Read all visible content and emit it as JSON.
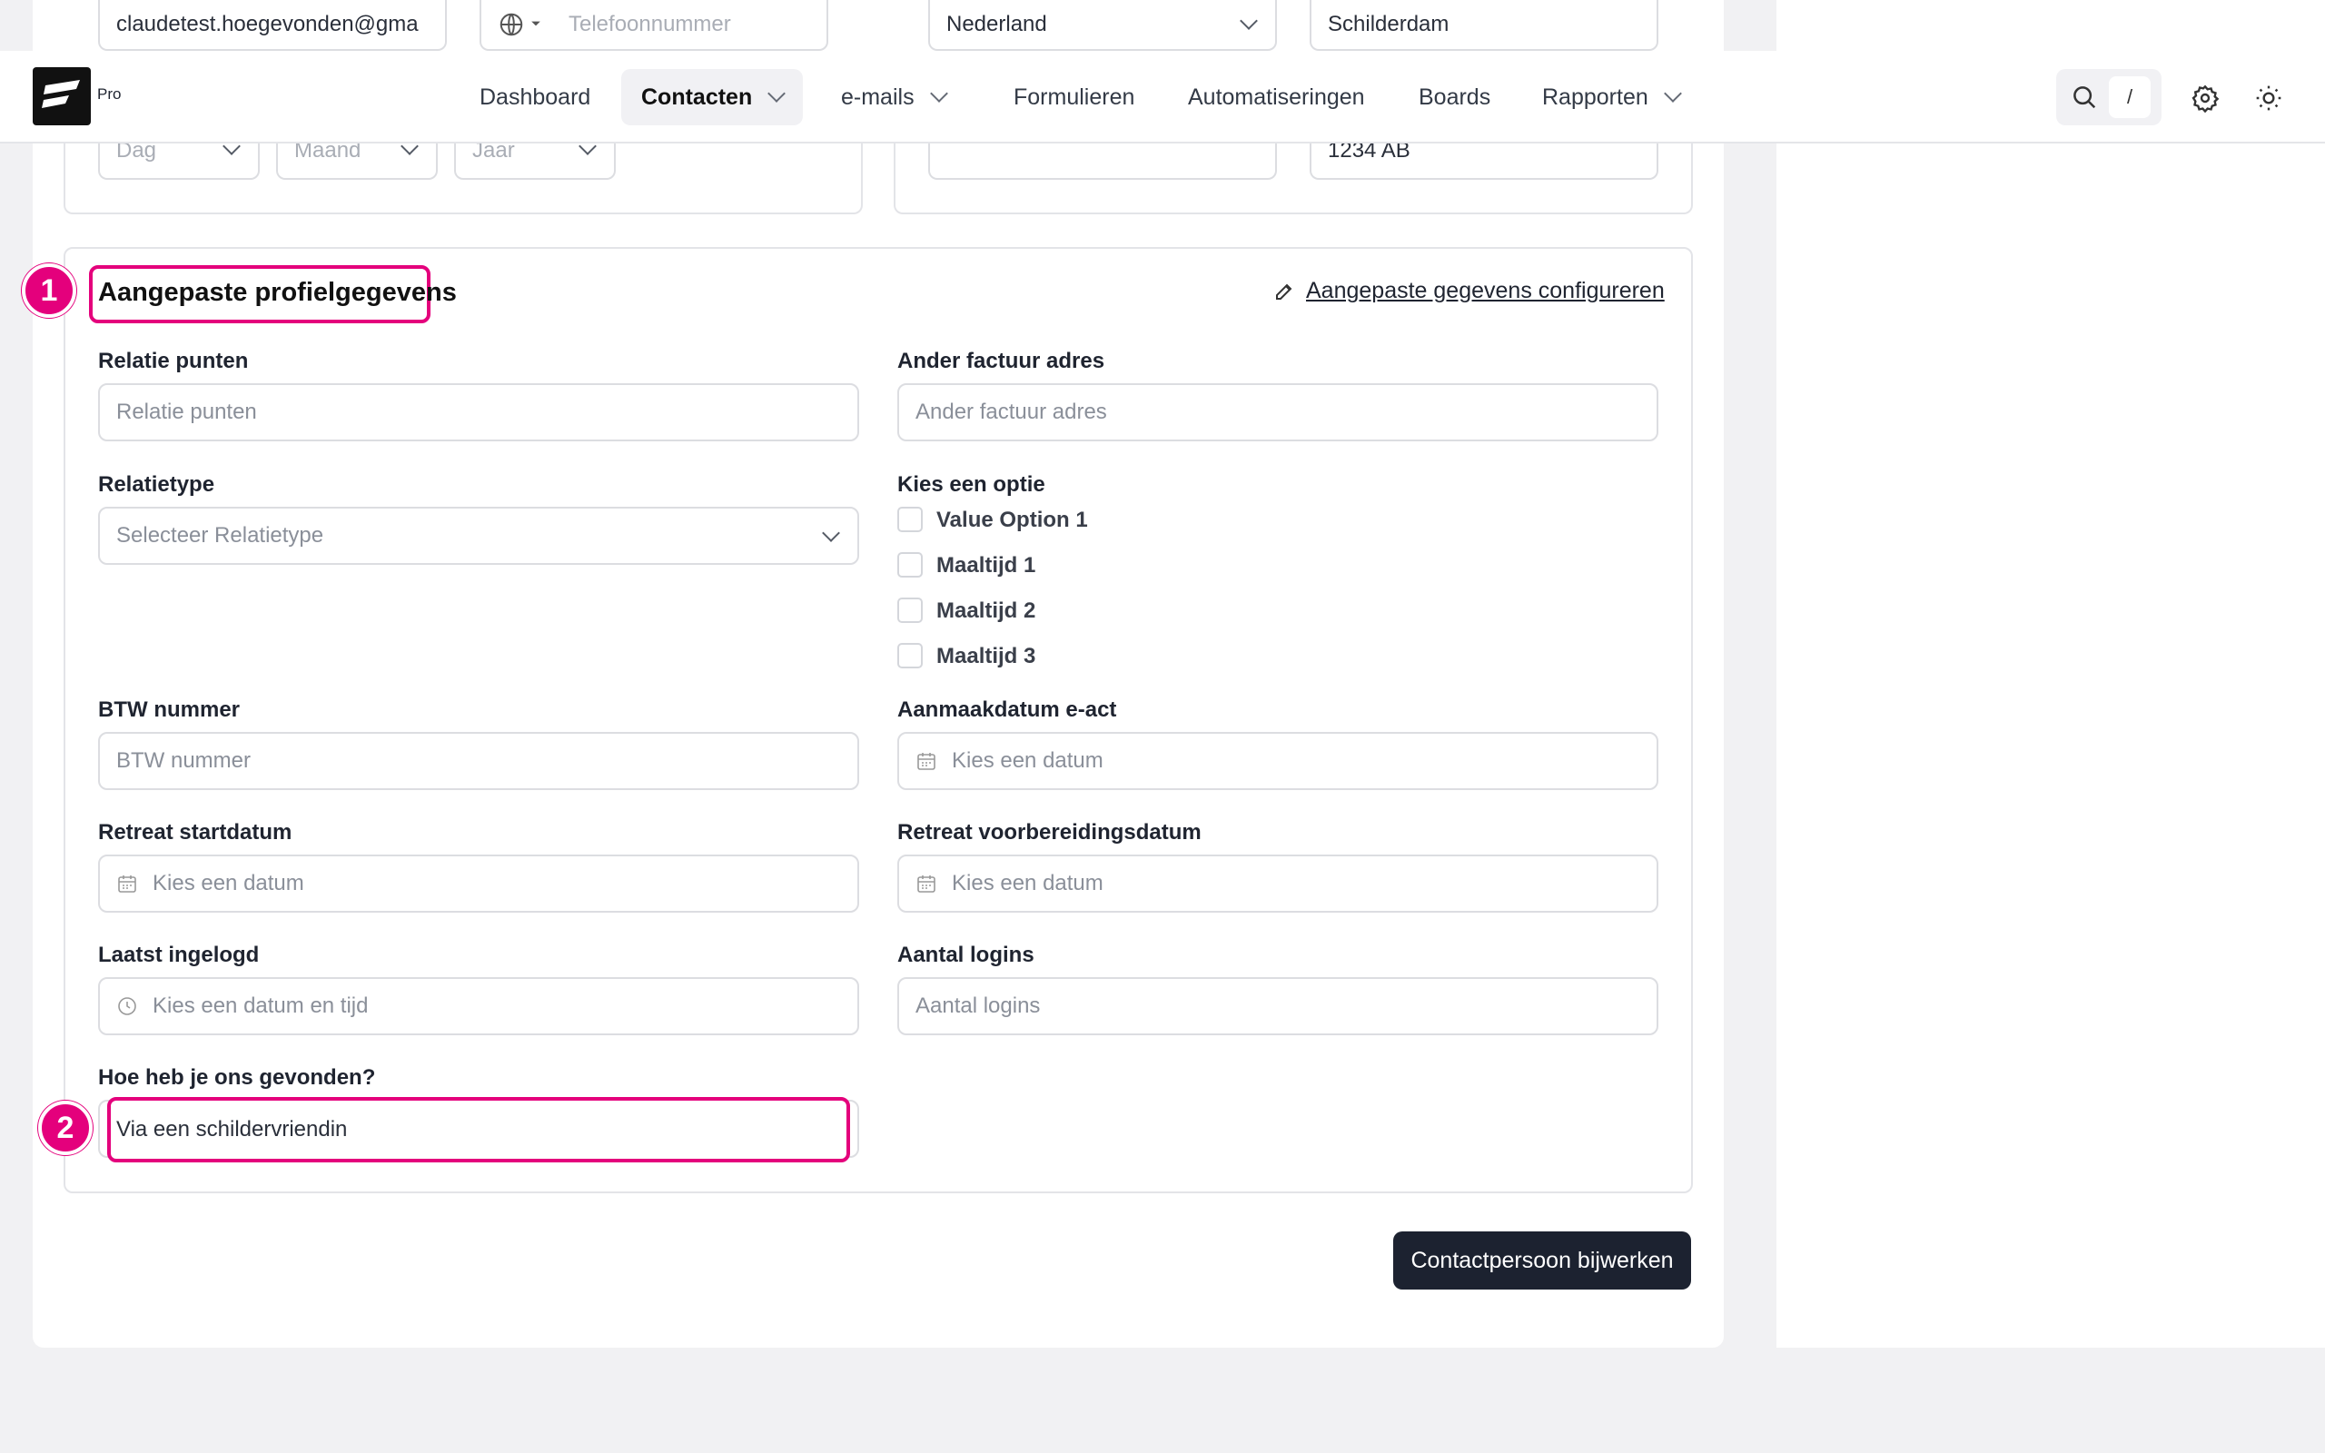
{
  "top_fields": {
    "email_value": "claudetest.hoegevonden@gma",
    "phone_placeholder": "Telefoonnummer",
    "country_value": "Nederland",
    "city_value": "Schilderdam",
    "day_placeholder": "Dag",
    "month_placeholder": "Maand",
    "year_placeholder": "Jaar",
    "zip_value": "1234 AB"
  },
  "nav": {
    "pro_label": "Pro",
    "items": [
      {
        "label": "Dashboard"
      },
      {
        "label": "Contacten"
      },
      {
        "label": "e-mails"
      },
      {
        "label": "Formulieren"
      },
      {
        "label": "Automatiseringen"
      },
      {
        "label": "Boards"
      },
      {
        "label": "Rapporten"
      }
    ],
    "search_shortcut": "/"
  },
  "custom_section": {
    "title": "Aangepaste profielgegevens",
    "config_link": "Aangepaste gegevens configureren",
    "fields": {
      "relatie_punten": {
        "label": "Relatie punten",
        "placeholder": "Relatie punten"
      },
      "ander_factuur": {
        "label": "Ander factuur adres",
        "placeholder": "Ander factuur adres"
      },
      "relatietype": {
        "label": "Relatietype",
        "placeholder": "Selecteer Relatietype"
      },
      "kies_optie": {
        "label": "Kies een optie",
        "options": [
          "Value Option 1",
          "Maaltijd 1",
          "Maaltijd 2",
          "Maaltijd 3"
        ]
      },
      "btw": {
        "label": "BTW nummer",
        "placeholder": "BTW nummer"
      },
      "aanmaakdatum": {
        "label": "Aanmaakdatum e-act",
        "placeholder": "Kies een datum"
      },
      "retreat_start": {
        "label": "Retreat startdatum",
        "placeholder": "Kies een datum"
      },
      "retreat_prep": {
        "label": "Retreat voorbereidingsdatum",
        "placeholder": "Kies een datum"
      },
      "laatst_ingelogd": {
        "label": "Laatst ingelogd",
        "placeholder": "Kies een datum en tijd"
      },
      "aantal_logins": {
        "label": "Aantal logins",
        "placeholder": "Aantal logins"
      },
      "gevonden": {
        "label": "Hoe heb je ons gevonden?",
        "value": "Via een schildervriendin"
      }
    }
  },
  "annotations": [
    "1",
    "2"
  ],
  "submit_label": "Contactpersoon bijwerken",
  "colors": {
    "highlight": "#e4007c",
    "button": "#1c2230"
  }
}
